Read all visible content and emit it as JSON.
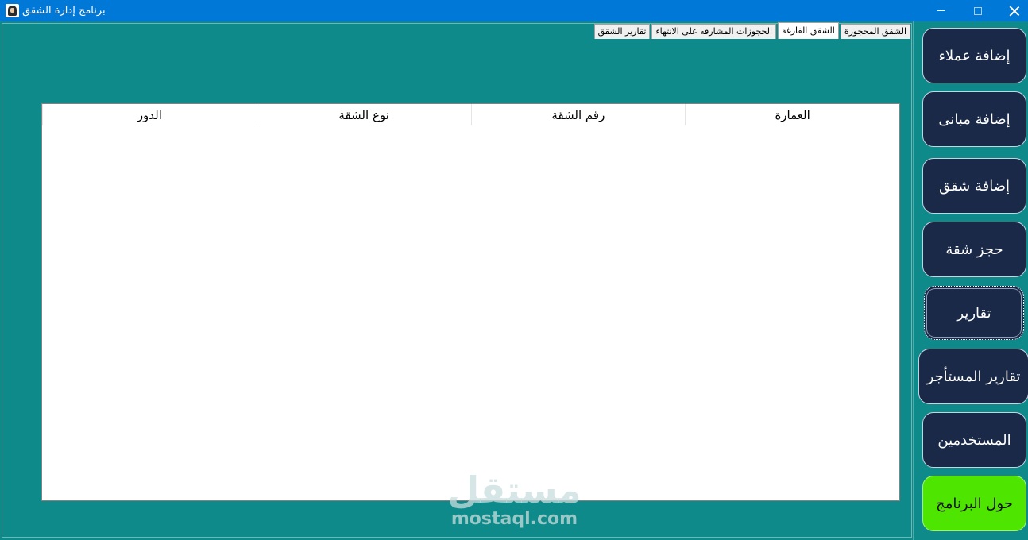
{
  "window": {
    "title": "برنامج إدارة الشقق"
  },
  "tabs": [
    {
      "label": "الشقق المحجوزة",
      "selected": false
    },
    {
      "label": "الشقق الفارغة",
      "selected": true
    },
    {
      "label": "الحجوزات المشارفه على الانتهاء",
      "selected": false
    },
    {
      "label": "تقارير  الشقق",
      "selected": false
    }
  ],
  "grid": {
    "columns": [
      "العمارة",
      "رقم الشقة",
      "نوع الشقة",
      "الدور"
    ],
    "rows": []
  },
  "sidebar": {
    "buttons": [
      {
        "label": "إضافة عملاء"
      },
      {
        "label": "إضافة مبانى"
      },
      {
        "label": "إضافة شقق"
      },
      {
        "label": "حجز شقة"
      },
      {
        "label": "تقارير"
      },
      {
        "label": "تقارير المستأجر"
      },
      {
        "label": "المستخدمين"
      },
      {
        "label": "حول البرنامج"
      }
    ]
  },
  "watermark": {
    "arabic": "مستقل",
    "english": "mostaql.com"
  },
  "colors": {
    "titlebar": "#0078d7",
    "background": "#0e8a8a",
    "button_navy": "#1a2947",
    "button_green": "#4ee600"
  }
}
